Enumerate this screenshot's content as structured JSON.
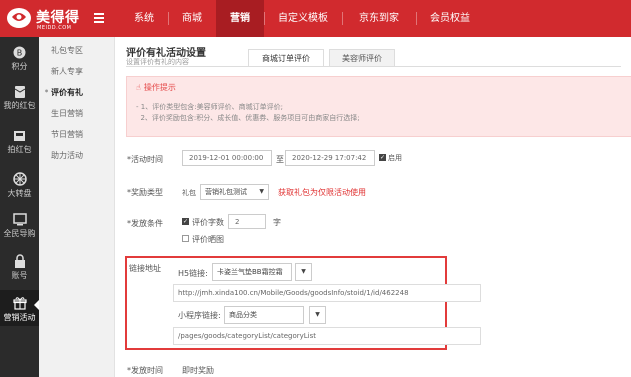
{
  "header": {
    "brand_name": "美得得",
    "brand_sub": "MEIDD.COM",
    "nav": [
      {
        "label": "系统"
      },
      {
        "label": "商城"
      },
      {
        "label": "营销",
        "active": true
      },
      {
        "label": "自定义模板"
      },
      {
        "label": "京东到家"
      },
      {
        "label": "会员权益"
      }
    ],
    "accent_color": "#d12a2e"
  },
  "rail": {
    "items": [
      {
        "label": "积分",
        "icon": "points-icon"
      },
      {
        "label": "红包",
        "label_prefix": "我的",
        "icon": "red-packet-icon"
      },
      {
        "label": "拍红包",
        "icon": "grab-red-packet-icon"
      },
      {
        "label": "大转盘",
        "icon": "wheel-icon"
      },
      {
        "label": "全民导购",
        "icon": "shopping-guide-icon"
      },
      {
        "label": "账号",
        "icon": "lock-icon"
      },
      {
        "label": "营销活动",
        "icon": "gift-icon",
        "active": true
      }
    ]
  },
  "subnav": {
    "items": [
      {
        "label": "礼包专区"
      },
      {
        "label": "新人专享"
      },
      {
        "label": "评价有礼",
        "active": true
      },
      {
        "label": "生日营销"
      },
      {
        "label": "节日营销"
      },
      {
        "label": "助力活动"
      }
    ]
  },
  "page": {
    "title": "评价有礼活动设置",
    "subtitle": "设置评价有礼的内容",
    "tabs": [
      {
        "label": "商城订单评价",
        "active": true
      },
      {
        "label": "美容师评价"
      }
    ]
  },
  "tip": {
    "title": "操作提示",
    "lines": [
      "1、评价类型包含:美容师评价、商城订单评价;",
      "2、评价奖励包含:积分、成长值、优惠券、服务项目可由商家自行选择;"
    ]
  },
  "form": {
    "time_label": "*活动时间",
    "start_time": "2019-12-01 00:00:00",
    "to_text": "至",
    "end_time": "2020-12-29 17:07:42",
    "enable_label": "启用",
    "enable_checked": true,
    "reward_label": "*奖励类型",
    "reward_type": "礼包",
    "reward_select": "营销礼包测试",
    "reward_link": "获取礼包为仅限活动使用",
    "condition_label": "*发放条件",
    "cond_words_label": "评价字数",
    "cond_words_checked": true,
    "cond_words_value": "2",
    "cond_words_unit": "字",
    "cond_image_label": "评价晒图",
    "cond_image_checked": false,
    "link_label": "链接地址",
    "h5_label": "H5链接:",
    "h5_select": "卡姿兰气垫BB霜控霜",
    "h5_url": "http://jmh.xinda100.cn/Mobile/Goods/goodsInfo/stoid/1/id/462248",
    "mini_label": "小程序链接:",
    "mini_select": "商品分类",
    "mini_url": "/pages/goods/categoryList/categoryList",
    "issue_label": "*发放时间",
    "issue_value": "即时奖励"
  }
}
